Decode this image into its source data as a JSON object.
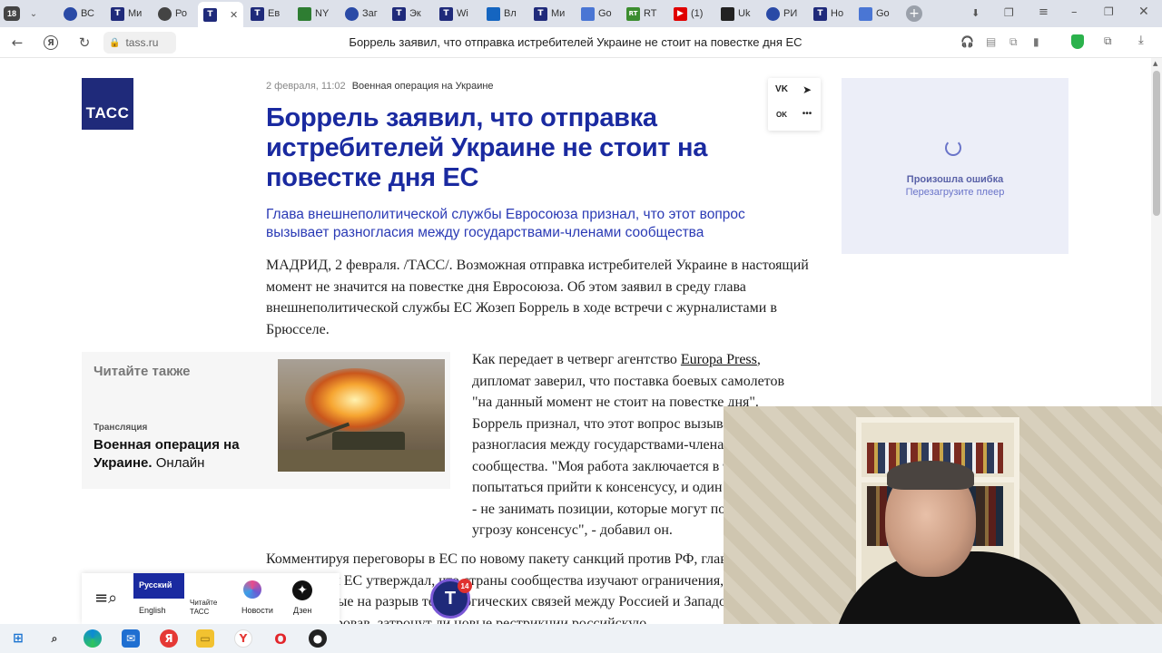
{
  "browser": {
    "tab_count": "18",
    "tabs": [
      {
        "label": "ВС",
        "icon": "globe-icon",
        "color": "#2a4aa6"
      },
      {
        "label": "Ми",
        "icon": "tass-icon",
        "color": "#1f2a7a"
      },
      {
        "label": "Ро",
        "icon": "circle-icon",
        "color": "#444444"
      },
      {
        "label": "Ев",
        "icon": "tass-icon",
        "color": "#1f2a7a"
      },
      {
        "label": "NY",
        "icon": "nyt-icon",
        "color": "#2e7d32"
      },
      {
        "label": "Заг",
        "icon": "globe-icon",
        "color": "#2a4aa6"
      },
      {
        "label": "Эк",
        "icon": "tass-icon",
        "color": "#1f2a7a"
      },
      {
        "label": "Wi",
        "icon": "tass-icon",
        "color": "#1f2a7a"
      },
      {
        "label": "Вл",
        "icon": "image-icon",
        "color": "#1565c0"
      },
      {
        "label": "Ми",
        "icon": "tass-icon",
        "color": "#1f2a7a"
      },
      {
        "label": "Go",
        "icon": "translate-icon",
        "color": "#4a76d4"
      },
      {
        "label": "RT",
        "icon": "rt-icon",
        "color": "#3c8d2f"
      },
      {
        "label": "(1)",
        "icon": "youtube-icon",
        "color": "#e00000"
      },
      {
        "label": "Uk",
        "icon": "uk-icon",
        "color": "#222222"
      },
      {
        "label": "РИ",
        "icon": "globe-icon",
        "color": "#2a4aa6"
      },
      {
        "label": "Но",
        "icon": "tass-icon",
        "color": "#1f2a7a"
      },
      {
        "label": "Go",
        "icon": "translate-icon",
        "color": "#4a76d4"
      }
    ],
    "url": "tass.ru",
    "page_title": "Боррель заявил, что отправка истребителей Украине не стоит на повестке дня ЕС"
  },
  "article": {
    "logo": "ТАСС",
    "date": "2 февраля, 11:02",
    "rubric": "Военная операция на Украине",
    "title": "Боррель заявил, что отправка истребителей Украине не стоит на повестке дня ЕС",
    "lead": "Глава внешнеполитической службы Евросоюза признал, что этот вопрос вызывает разногласия между государствами-членами сообщества",
    "paragraph1": "МАДРИД, 2 февраля. /ТАСС/. Возможная отправка истребителей Украине в настоящий момент не значится на повестке дня Евросоюза. Об этом заявил в среду глава внешнеполитической службы ЕС Жозеп Боррель в ходе встречи с журналистами в Брюсселе.",
    "p2_before_link": "Как передает в четверг агентство ",
    "p2_link": "Europa Press",
    "p2_after_link": ", дипломат заверил, что поставка боевых самолетов \"на данный момент не стоит на повестке дня\". Боррель признал, что этот вопрос вызывает разногласия между государствами-членами сообщества. \"Моя работа заключается в том, чтобы попытаться прийти к консенсусу, и один из способов - не занимать позиции, которые могут поставить под угрозу консенсус\", - добавил он.",
    "paragraph3": "Комментируя переговоры в ЕС по новому пакету санкций против РФ, глава дипломатии ЕС утверждал, что страны сообщества изучают ограничения, направленные на разрыв технологических связей между Россией и Западом, не конкретизировав, затронут ли новые рестрикции российскую"
  },
  "read_also": {
    "heading": "Читайте также",
    "tag": "Трансляция",
    "title_bold": "Военная операция на Украине.",
    "title_rest": " Онлайн"
  },
  "share": {
    "vk": "VK",
    "tg": "➤",
    "ok": "OK",
    "more": "•••"
  },
  "player": {
    "error": "Произошла ошибка",
    "reload": "Перезагрузите плеер"
  },
  "bottom_bar": {
    "lang_active": "Русский",
    "lang_other": "English",
    "read_tass": "Читайте ТАСС",
    "news": "Новости",
    "zen": "Дзен",
    "badge_count": "14"
  },
  "colors": {
    "tass_blue": "#1f2a7a",
    "title_blue": "#1a2aa0",
    "lead_blue": "#2a3ab5",
    "link": "#111111"
  }
}
